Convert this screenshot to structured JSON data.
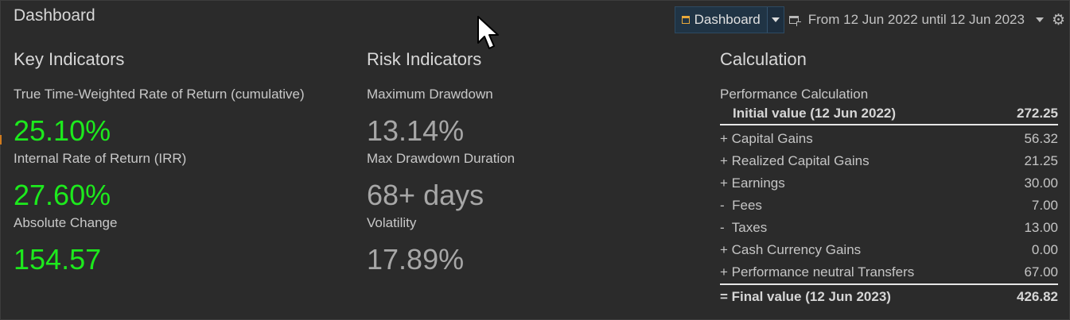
{
  "header": {
    "title": "Dashboard",
    "dashboard_select": "Dashboard",
    "period": "From 12 Jun 2022 until 12 Jun 2023"
  },
  "key_indicators": {
    "title": "Key Indicators",
    "items": [
      {
        "label": "True Time-Weighted Rate of Return (cumulative)",
        "value": "25.10%"
      },
      {
        "label": "Internal Rate of Return (IRR)",
        "value": "27.60%"
      },
      {
        "label": "Absolute Change",
        "value": "154.57"
      }
    ]
  },
  "risk_indicators": {
    "title": "Risk Indicators",
    "items": [
      {
        "label": "Maximum Drawdown",
        "value": "13.14%"
      },
      {
        "label": "Max Drawdown Duration",
        "value": "68+ days"
      },
      {
        "label": "Volatility",
        "value": "17.89%"
      }
    ]
  },
  "calculation": {
    "title": "Calculation",
    "subtitle": "Performance Calculation",
    "initial": {
      "label": "Initial value (12 Jun 2022)",
      "value": "272.25"
    },
    "rows": [
      {
        "label": "+ Capital Gains",
        "value": "56.32"
      },
      {
        "label": "+ Realized Capital Gains",
        "value": "21.25"
      },
      {
        "label": "+ Earnings",
        "value": "30.00"
      },
      {
        "label": "-  Fees",
        "value": "7.00"
      },
      {
        "label": "-  Taxes",
        "value": "13.00"
      },
      {
        "label": "+ Cash Currency Gains",
        "value": "0.00"
      },
      {
        "label": "+ Performance neutral Transfers",
        "value": "67.00"
      }
    ],
    "final": {
      "label": "= Final value (12 Jun 2023)",
      "value": "426.82"
    }
  },
  "colors": {
    "positive": "#1dea1d",
    "neutral": "#a7a7a7",
    "background": "#2b2b2b",
    "accent": "#e8a93a"
  },
  "icons": [
    "dashboard-icon",
    "chevron-down-icon",
    "new-window-icon",
    "gear-icon",
    "mouse-cursor-icon"
  ]
}
